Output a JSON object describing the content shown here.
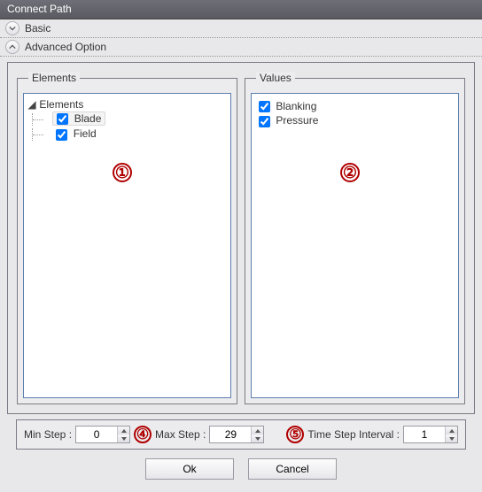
{
  "window": {
    "title": "Connect Path"
  },
  "sections": {
    "basic": "Basic",
    "advanced": "Advanced Option"
  },
  "elements_group": {
    "legend": "Elements",
    "root_label": "Elements",
    "items": [
      {
        "label": "Blade",
        "checked": true,
        "selected": true
      },
      {
        "label": "Field",
        "checked": true,
        "selected": false
      }
    ]
  },
  "values_group": {
    "legend": "Values",
    "items": [
      {
        "label": "Blanking",
        "checked": true
      },
      {
        "label": "Pressure",
        "checked": true
      }
    ]
  },
  "annotations": {
    "a1": "①",
    "a2": "②",
    "a4": "④",
    "a5": "⑤"
  },
  "steps": {
    "min_label": "Min Step :",
    "min_value": "0",
    "max_label": "Max Step :",
    "max_value": "29",
    "interval_label": "Time Step Interval :",
    "interval_value": "1"
  },
  "buttons": {
    "ok": "Ok",
    "cancel": "Cancel"
  }
}
